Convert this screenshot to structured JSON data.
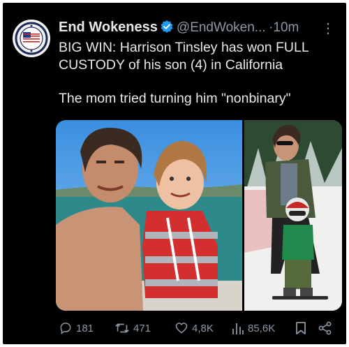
{
  "post": {
    "author_name": "End Wokeness",
    "handle": "@EndWoken...",
    "separator": "·",
    "time": "10m",
    "more_icon": "more-dots-icon",
    "text_line1": "BIG WIN: Harrison Tinsley has won FULL CUSTODY of his son (4) in California",
    "text_line2": "The mom tried turning him \"nonbinary\""
  },
  "avatar": {
    "badge_text_top": "END WOKENESS",
    "badge_text_bottom": "WOKENESS"
  },
  "actions": {
    "replies": "181",
    "reposts": "471",
    "likes": "4,8K",
    "views": "85,6K"
  },
  "colors": {
    "background": "#000000",
    "text": "#e7e9ea",
    "secondary": "#8b98a5",
    "verified": "#1d9bf0"
  }
}
